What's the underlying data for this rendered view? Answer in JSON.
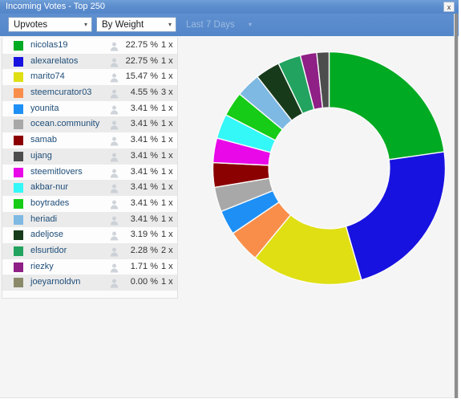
{
  "window": {
    "title": "Incoming Votes - Top 250",
    "close_label": "x"
  },
  "toolbar": {
    "vote_type": {
      "value": "Upvotes",
      "arrow": "▾",
      "icon": "chevron-down-icon"
    },
    "sort_by": {
      "value": "By Weight",
      "arrow": "▾",
      "icon": "chevron-down-icon"
    },
    "period": {
      "value": "Last 7 Days",
      "arrow": "▾",
      "icon": "chevron-down-icon",
      "disabled": true
    }
  },
  "list": {
    "person_icon": "person-icon",
    "rows": [
      {
        "name": "nicolas19",
        "percent": "22.75 %",
        "count": "1 x",
        "color": "#00aa22"
      },
      {
        "name": "alexarelatos",
        "percent": "22.75 %",
        "count": "1 x",
        "color": "#1812e0"
      },
      {
        "name": "marito74",
        "percent": "15.47 %",
        "count": "1 x",
        "color": "#dfdf14"
      },
      {
        "name": "steemcurator03",
        "percent": "4.55 %",
        "count": "3 x",
        "color": "#f98e4a"
      },
      {
        "name": "younita",
        "percent": "3.41 %",
        "count": "1 x",
        "color": "#1e90f5"
      },
      {
        "name": "ocean.community",
        "percent": "3.41 %",
        "count": "1 x",
        "color": "#a8a8a8"
      },
      {
        "name": "samab",
        "percent": "3.41 %",
        "count": "1 x",
        "color": "#8b0000"
      },
      {
        "name": "ujang",
        "percent": "3.41 %",
        "count": "1 x",
        "color": "#4d4d4d"
      },
      {
        "name": "steemitlovers",
        "percent": "3.41 %",
        "count": "1 x",
        "color": "#e808e8"
      },
      {
        "name": "akbar-nur",
        "percent": "3.41 %",
        "count": "1 x",
        "color": "#34f7f7"
      },
      {
        "name": "boytrades",
        "percent": "3.41 %",
        "count": "1 x",
        "color": "#16cc16"
      },
      {
        "name": "heriadi",
        "percent": "3.41 %",
        "count": "1 x",
        "color": "#7db9e2"
      },
      {
        "name": "adeljose",
        "percent": "3.19 %",
        "count": "1 x",
        "color": "#173a1b"
      },
      {
        "name": "elsurtidor",
        "percent": "2.28 %",
        "count": "2 x",
        "color": "#22a35f"
      },
      {
        "name": "riezky",
        "percent": "1.71 %",
        "count": "1 x",
        "color": "#8e2086"
      },
      {
        "name": "joeyarnoldvn",
        "percent": "0.00 %",
        "count": "1 x",
        "color": "#8a8a6b"
      }
    ]
  },
  "chart_data": {
    "type": "pie",
    "variant": "donut",
    "title": "Incoming Votes - Top 250",
    "start_angle_deg": 0,
    "direction": "clockwise",
    "inner_radius_ratio": 0.52,
    "legend": "left-list",
    "unit": "%",
    "categories": [
      "nicolas19",
      "alexarelatos",
      "marito74",
      "steemcurator03",
      "younita",
      "ocean.community",
      "samab",
      "ujang",
      "steemitlovers",
      "akbar-nur",
      "boytrades",
      "heriadi",
      "adeljose",
      "elsurtidor",
      "riezky",
      "joeyarnoldvn"
    ],
    "values": [
      22.75,
      22.75,
      15.47,
      4.55,
      3.41,
      3.41,
      3.41,
      3.41,
      3.41,
      3.41,
      3.41,
      3.41,
      3.19,
      2.28,
      1.71,
      0.0
    ],
    "colors": [
      "#00aa22",
      "#1812e0",
      "#dfdf14",
      "#f98e4a",
      "#1e90f5",
      "#a8a8a8",
      "#8b0000",
      "#e808e8",
      "#34f7f7",
      "#16cc16",
      "#7db9e2",
      "#173a1b",
      "#22a35f",
      "#8e2086",
      "#4d4d4d",
      "#8a8a6b"
    ],
    "slice_order_clockwise": [
      "nicolas19",
      "alexarelatos",
      "marito74",
      "steemcurator03",
      "younita",
      "ocean.community",
      "samab",
      "ujang",
      "steemitlovers",
      "akbar-nur",
      "boytrades",
      "heriadi",
      "adeljose",
      "elsurtidor",
      "riezky"
    ]
  }
}
